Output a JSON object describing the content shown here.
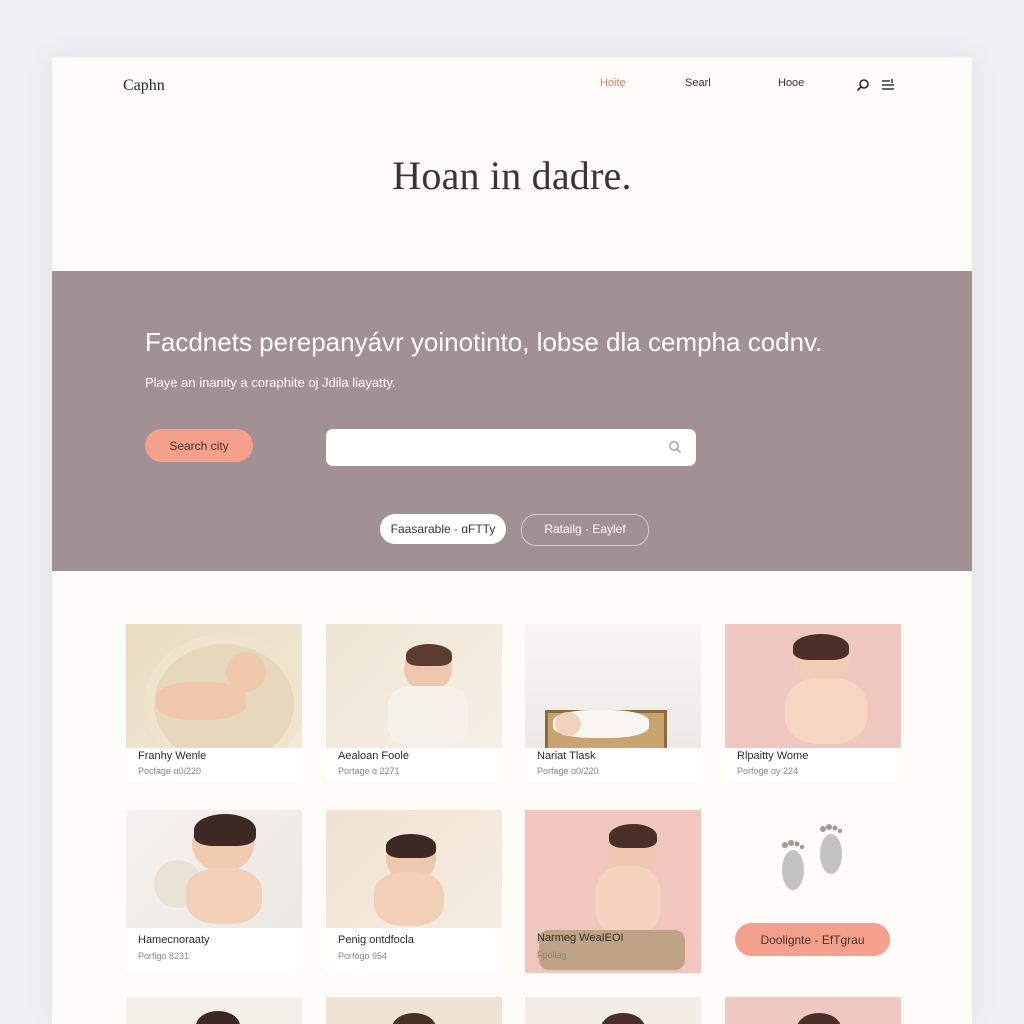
{
  "nav": {
    "logo": "Caphn",
    "links": [
      "Hoite",
      "Searl",
      "Hooe"
    ]
  },
  "hero": {
    "title": "Hoan in dadre."
  },
  "band": {
    "title": "Facdnets perepanyávr yoinotinto, lobse dla cempha codnv.",
    "subtitle": "Playe an inanity a coraphite oj Jdila liayatty.",
    "search_button": "Search city",
    "search_placeholder": "",
    "pills": [
      "Faasarable · ɑFTTy",
      "Ratailg · Eaylef"
    ]
  },
  "cards": [
    {
      "name": "Franhy Wenle",
      "meta": "Pocfage ɑ0/220"
    },
    {
      "name": "Aealoan Foole",
      "meta": "Portage ɑ 2271"
    },
    {
      "name": "Nariat Tlask",
      "meta": "Porfage ɑ0/220"
    },
    {
      "name": "Rlpaitty Wome",
      "meta": "Porfoge ɑy 224"
    },
    {
      "name": "Hamecnoraaty",
      "meta": "Porfigo 8231"
    },
    {
      "name": "Penig ontdfocla",
      "meta": "Porfogo 954"
    },
    {
      "name": "Narmeg WeaIEOI",
      "meta": "Fpoliag"
    }
  ],
  "cta": {
    "label": "Doolignte - EfTgrau"
  },
  "colors": {
    "accent": "#e37a63",
    "button": "#f4a08b",
    "band": "#a29193",
    "page": "#fdfcf8"
  }
}
